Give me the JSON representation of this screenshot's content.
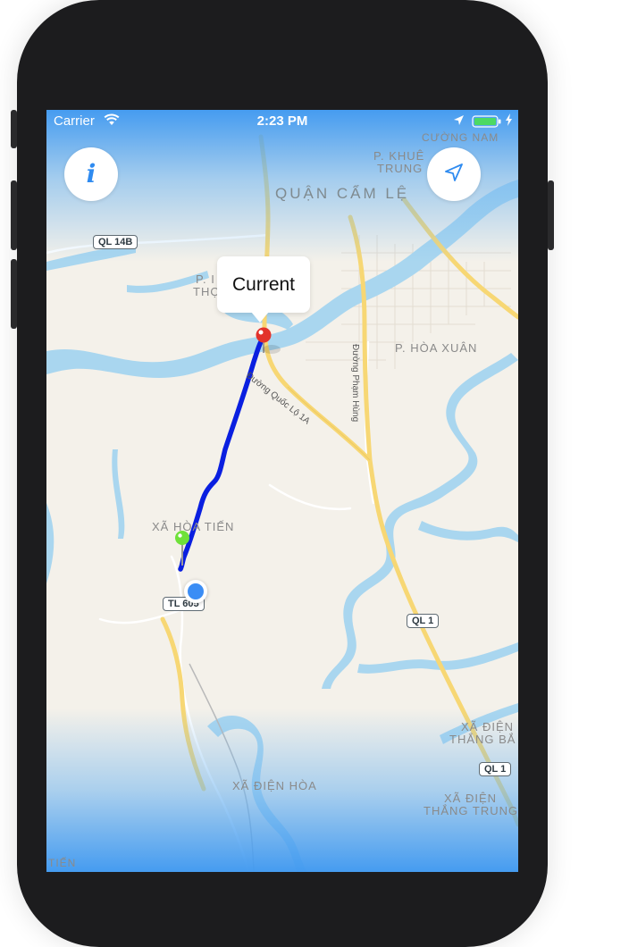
{
  "status_bar": {
    "carrier": "Carrier",
    "time": "2:23 PM",
    "wifi_icon": "wifi-icon",
    "location_icon": "location-arrow-icon",
    "battery_icon": "battery-icon",
    "charging_icon": "charging-bolt-icon"
  },
  "buttons": {
    "info_icon": "info-icon",
    "info_glyph": "i",
    "locate_icon": "location-arrow-icon"
  },
  "callout": {
    "title": "Current"
  },
  "map": {
    "labels": {
      "district": "QUẬN CẨM LỆ",
      "ward_khue_trung_1": "P. KHUÊ",
      "ward_khue_trung_2": "TRUNG",
      "ward_cuong_nam": "CƯỜNG NAM",
      "ward_tho_1": "P. I",
      "ward_tho_2": "THỌ",
      "ward_hoa_xuan": "P. HÒA XUÂN",
      "xa_hoa_tien": "XÃ HÒA TIẾN",
      "xa_dien_thang_bac_1": "XÃ ĐIỆN",
      "xa_dien_thang_bac_2": "THẮNG BẮ",
      "xa_dien_hoa": "XÃ ĐIỆN HÒA",
      "xa_dien_thang_trung_1": "XÃ ĐIỆN",
      "xa_dien_thang_trung_2": "THẮNG TRUNG",
      "tien": "TIẾN"
    },
    "road_labels": {
      "quoc_lo_1a": "Đường Quốc Lộ 1A",
      "pham_hung": "Đường Phạm Hùng"
    },
    "shields": {
      "ql14b": "QL 14B",
      "tl605": "TL 605",
      "ql1_a": "QL 1",
      "ql1_b": "QL 1"
    },
    "colors": {
      "land": "#f4f1ea",
      "water": "#a9d6ef",
      "route": "#0a1fe0",
      "major_road": "#f7d774",
      "minor_road": "#ffffff",
      "destination_pin": "#e3322b",
      "start_pin": "#6fe13a",
      "user_location": "#3b8df5",
      "accent": "#2f8bf0"
    }
  }
}
